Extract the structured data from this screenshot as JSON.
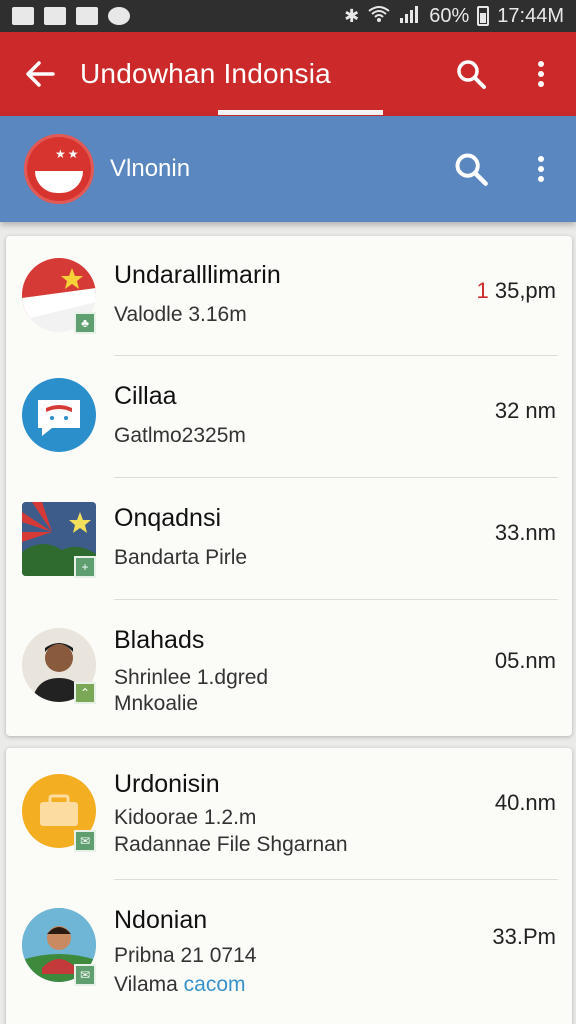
{
  "status_bar": {
    "battery": "60%",
    "time": "17:44M"
  },
  "app_bar": {
    "title": "Undowhan Indonsia"
  },
  "sub_bar": {
    "title": "Vlnonin"
  },
  "colors": {
    "app_bar": "#cc2a2a",
    "sub_bar": "#5a87bf",
    "accent_time": "#cc2a2a",
    "link": "#3a93c8"
  },
  "conversations": [
    {
      "name": "Undaralllimarin",
      "line1": "Valodle 3.16m",
      "line2": "",
      "time_accent": "1",
      "time_rest": "35,pm"
    },
    {
      "name": "Cillaa",
      "line1": "Gatlmo2325m",
      "line2": "",
      "time_accent": "",
      "time_rest": "32 nm"
    },
    {
      "name": "Onqadnsi",
      "line1": "Bandarta Pirle",
      "line2": "",
      "time_accent": "",
      "time_rest": "33.nm"
    },
    {
      "name": "Blahads",
      "line1": "Shrinlee 1.dgred",
      "line2": "Mnkoalie",
      "time_accent": "",
      "time_rest": "05.nm"
    },
    {
      "name": "Urdonisin",
      "line1": "Kidoorae 1.2.m",
      "line2": "Radannae File Shgarnan",
      "time_accent": "",
      "time_rest": "40.nm"
    },
    {
      "name": "Ndonian",
      "line1": "Pribna 21 0714",
      "line2_plain": "Vilama",
      "line2_link": "cacom",
      "time_accent": "",
      "time_rest": "33.Pm"
    }
  ],
  "icons": [
    "back-arrow-icon",
    "search-icon",
    "more-vert-icon",
    "bluetooth-icon",
    "wifi-icon",
    "signal-icon",
    "battery-icon"
  ]
}
